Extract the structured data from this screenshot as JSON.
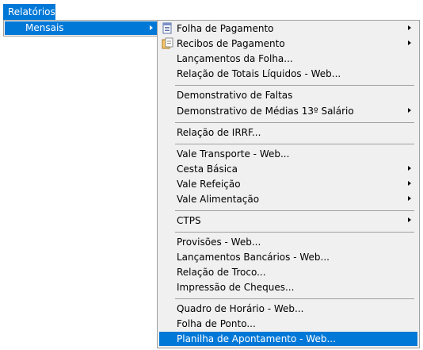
{
  "menubar": {
    "label": "Relatórios"
  },
  "level1": {
    "label": "Mensais"
  },
  "level2": {
    "items": [
      {
        "label": "Folha de Pagamento",
        "submenu": true,
        "icon": "document-list-icon"
      },
      {
        "label": "Recibos de Pagamento",
        "submenu": true,
        "icon": "documents-icon"
      },
      {
        "label": "Lançamentos da Folha...",
        "submenu": false
      },
      {
        "label": "Relação de Totais Líquidos - Web...",
        "submenu": false
      },
      {
        "label": "Demonstrativo de Faltas",
        "submenu": false
      },
      {
        "label": "Demonstrativo de Médias 13º Salário",
        "submenu": true
      },
      {
        "label": "Relação de IRRF...",
        "submenu": false
      },
      {
        "label": "Vale Transporte - Web...",
        "submenu": false
      },
      {
        "label": "Cesta Básica",
        "submenu": true
      },
      {
        "label": "Vale Refeição",
        "submenu": true
      },
      {
        "label": "Vale Alimentação",
        "submenu": true
      },
      {
        "label": "CTPS",
        "submenu": true
      },
      {
        "label": "Provisões - Web...",
        "submenu": false
      },
      {
        "label": "Lançamentos Bancários - Web...",
        "submenu": false
      },
      {
        "label": "Relação de Troco...",
        "submenu": false
      },
      {
        "label": "Impressão de Cheques...",
        "submenu": false
      },
      {
        "label": "Quadro de Horário - Web...",
        "submenu": false
      },
      {
        "label": "Folha de Ponto...",
        "submenu": false
      },
      {
        "label": "Planilha de Apontamento - Web...",
        "submenu": false,
        "highlighted": true
      }
    ]
  },
  "colors": {
    "highlight": "#0078d7",
    "menu_background": "#f0f0f0",
    "separator": "#a0a0a0"
  }
}
